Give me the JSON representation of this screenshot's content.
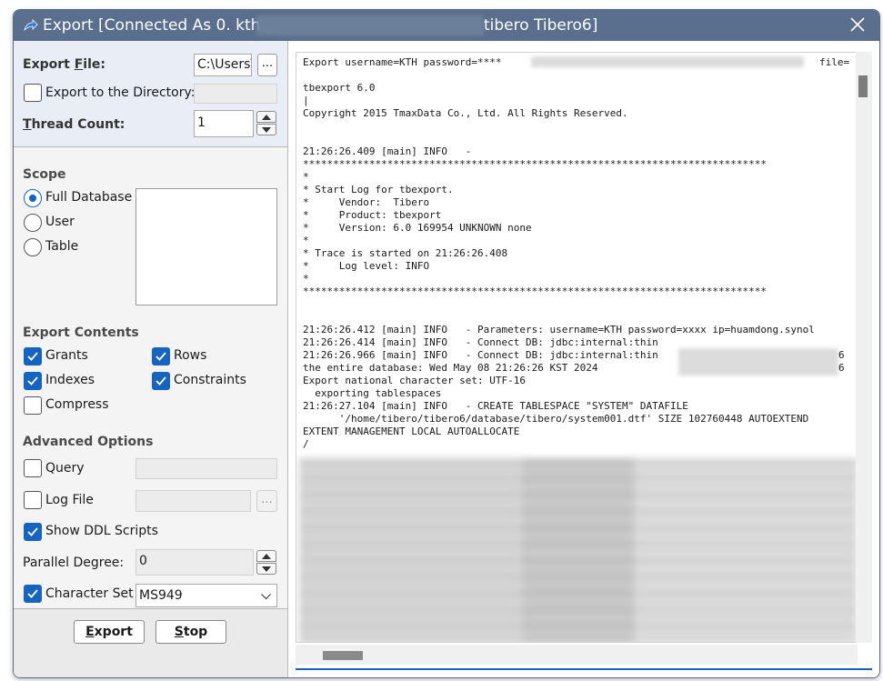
{
  "window": {
    "title_prefix": "Export [Connected As 0. kth@",
    "title_suffix": "tibero Tibero6]",
    "close_glyph": "✕"
  },
  "file_section": {
    "export_file_label_pre": "Export ",
    "export_file_label_key": "F",
    "export_file_label_post": "ile:",
    "export_file_value": "C:\\Users\\",
    "browse_label": "...",
    "export_dir_label": "Export to the Directory:",
    "export_dir_checked": false,
    "export_dir_value": "",
    "thread_label_key": "T",
    "thread_label_post": "hread Count:",
    "thread_value": "1"
  },
  "scope": {
    "title": "Scope",
    "options": [
      {
        "label": "Full Database",
        "selected": true
      },
      {
        "label": "User",
        "selected": false
      },
      {
        "label": "Table",
        "selected": false
      }
    ]
  },
  "export_contents": {
    "title": "Export Contents",
    "grants": {
      "label": "Grants",
      "checked": true
    },
    "rows": {
      "label": "Rows",
      "checked": true
    },
    "indexes": {
      "label": "Indexes",
      "checked": true
    },
    "constraints": {
      "label": "Constraints",
      "checked": true
    },
    "compress": {
      "label": "Compress",
      "checked": false
    }
  },
  "advanced": {
    "title": "Advanced Options",
    "query": {
      "label": "Query",
      "checked": false,
      "value": ""
    },
    "log_file": {
      "label": "Log File",
      "checked": false,
      "value": "",
      "browse_label": "..."
    },
    "show_ddl": {
      "label": "Show DDL Scripts",
      "checked": true
    },
    "parallel_label": "Parallel Degree:",
    "parallel_value": "0",
    "charset": {
      "label": "Character Set",
      "checked": true,
      "value": "MS949"
    }
  },
  "buttons": {
    "export_key": "E",
    "export_rest": "xport",
    "stop_key": "S",
    "stop_rest": "top"
  },
  "log": {
    "first_line_prefix": "Export username=KTH password=****",
    "first_line_suffix": "file=",
    "text": "\n\ntbexport 6.0\n|\nCopyright 2015 TmaxData Co., Ltd. All Rights Reserved.\n\n\n21:26:26.409 [main] INFO   -\n*****************************************************************************\n*\n* Start Log for tbexport.\n*     Vendor:  Tibero\n*     Product: tbexport\n*     Version: 6.0 169954 UNKNOWN none\n*\n* Trace is started on 21:26:26.408\n*     Log level: INFO\n*\n*****************************************************************************\n\n\n21:26:26.412 [main] INFO   - Parameters: username=KTH password=xxxx ip=huamdong.synol\n21:26:26.414 [main] INFO   - Connect DB: jdbc:internal:thin\n21:26:26.966 [main] INFO   - Connect DB: jdbc:internal:thin\nthe entire database: Wed May 08 21:26:26 KST 2024\nExport national character set: UTF-16\n  exporting tablespaces\n21:26:27.104 [main] INFO   - CREATE TABLESPACE \"SYSTEM\" DATAFILE\n      '/home/tibero/tibero6/database/tibero/system001.dtf' SIZE 102760448 AUTOEXTEND\nEXTENT MANAGEMENT LOCAL AUTOALLOCATE\n/",
    "line_end_digit_1": "6",
    "line_end_digit_2": "6"
  }
}
